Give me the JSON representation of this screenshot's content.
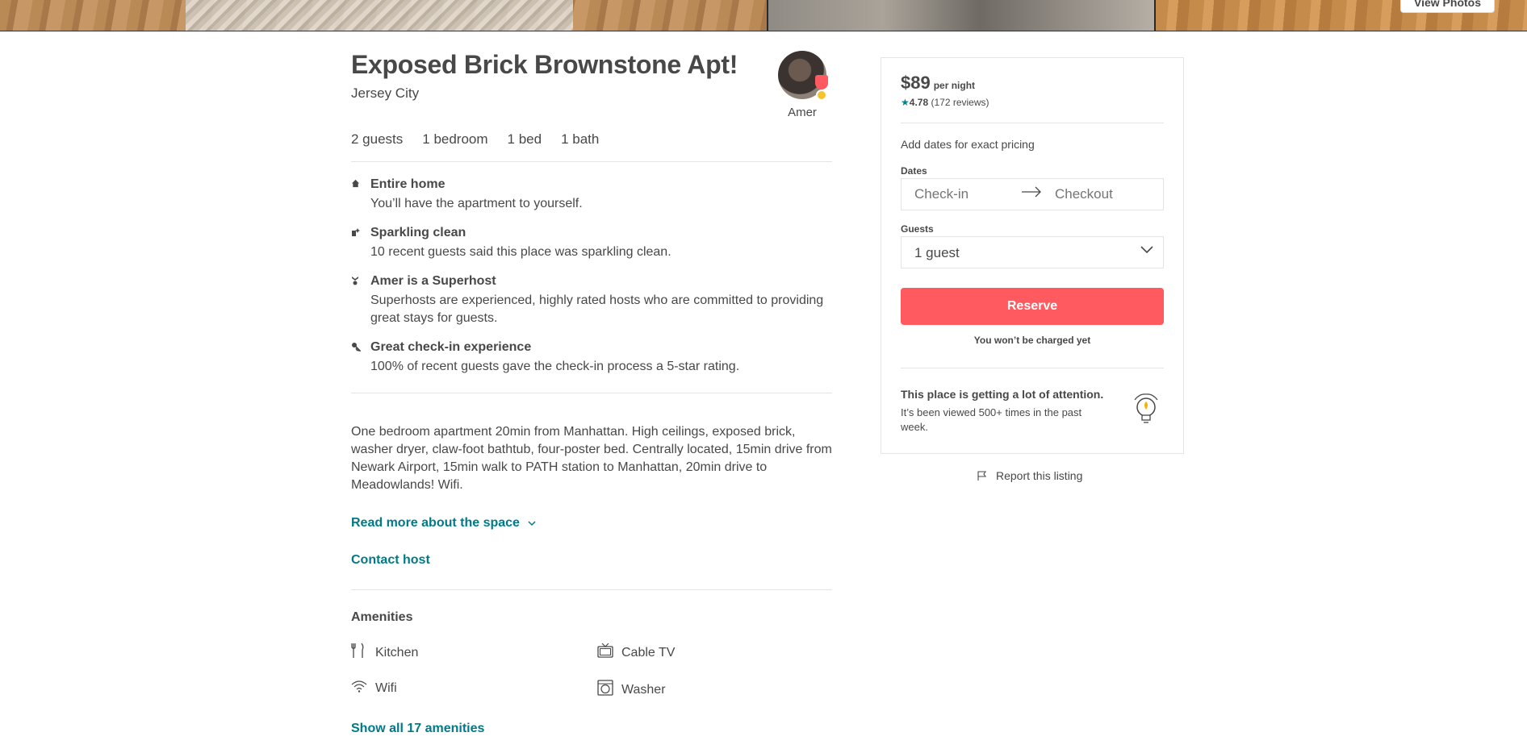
{
  "hero": {
    "view_photos_label": "View Photos"
  },
  "listing": {
    "title": "Exposed Brick Brownstone Apt!",
    "location": "Jersey City",
    "host_name": "Amer",
    "facts": [
      "2 guests",
      "1 bedroom",
      "1 bed",
      "1 bath"
    ]
  },
  "highlights": [
    {
      "icon": "home-icon",
      "title": "Entire home",
      "desc": "You’ll have the apartment to yourself."
    },
    {
      "icon": "sparkle-icon",
      "title": "Sparkling clean",
      "desc": "10 recent guests said this place was sparkling clean."
    },
    {
      "icon": "medal-icon",
      "title": "Amer is a Superhost",
      "desc": "Superhosts are experienced, highly rated hosts who are committed to providing great stays for guests."
    },
    {
      "icon": "key-icon",
      "title": "Great check-in experience",
      "desc": "100% of recent guests gave the check-in process a 5-star rating."
    }
  ],
  "description": "One bedroom apartment 20min from Manhattan. High ceilings, exposed brick, washer dryer, claw-foot bathtub, four-poster bed. Centrally located, 15min drive from Newark Airport, 15min walk to PATH station to Manhattan, 20min drive to Meadowlands! Wifi.",
  "links": {
    "read_more": "Read more about the space",
    "contact_host": "Contact host",
    "show_all_amenities": "Show all 17 amenities"
  },
  "amenities": {
    "title": "Amenities",
    "items": [
      {
        "icon": "kitchen-icon",
        "label": "Kitchen"
      },
      {
        "icon": "tv-icon",
        "label": "Cable TV"
      },
      {
        "icon": "wifi-icon",
        "label": "Wifi"
      },
      {
        "icon": "washer-icon",
        "label": "Washer"
      }
    ]
  },
  "booking": {
    "price": "$89",
    "per_night": "per night",
    "rating": "4.78",
    "reviews": "(172 reviews)",
    "add_dates": "Add dates for exact pricing",
    "dates_label": "Dates",
    "checkin_placeholder": "Check-in",
    "checkout_placeholder": "Checkout",
    "guests_label": "Guests",
    "guests_value": "1 guest",
    "reserve_label": "Reserve",
    "no_charge": "You won’t be charged yet",
    "attention_title": "This place is getting a lot of attention.",
    "attention_desc": "It’s been viewed 500+ times in the past week."
  },
  "report_label": "Report this listing",
  "colors": {
    "accent": "#ff5a5f",
    "link": "#007a87",
    "star": "#008489",
    "text": "#484848"
  }
}
